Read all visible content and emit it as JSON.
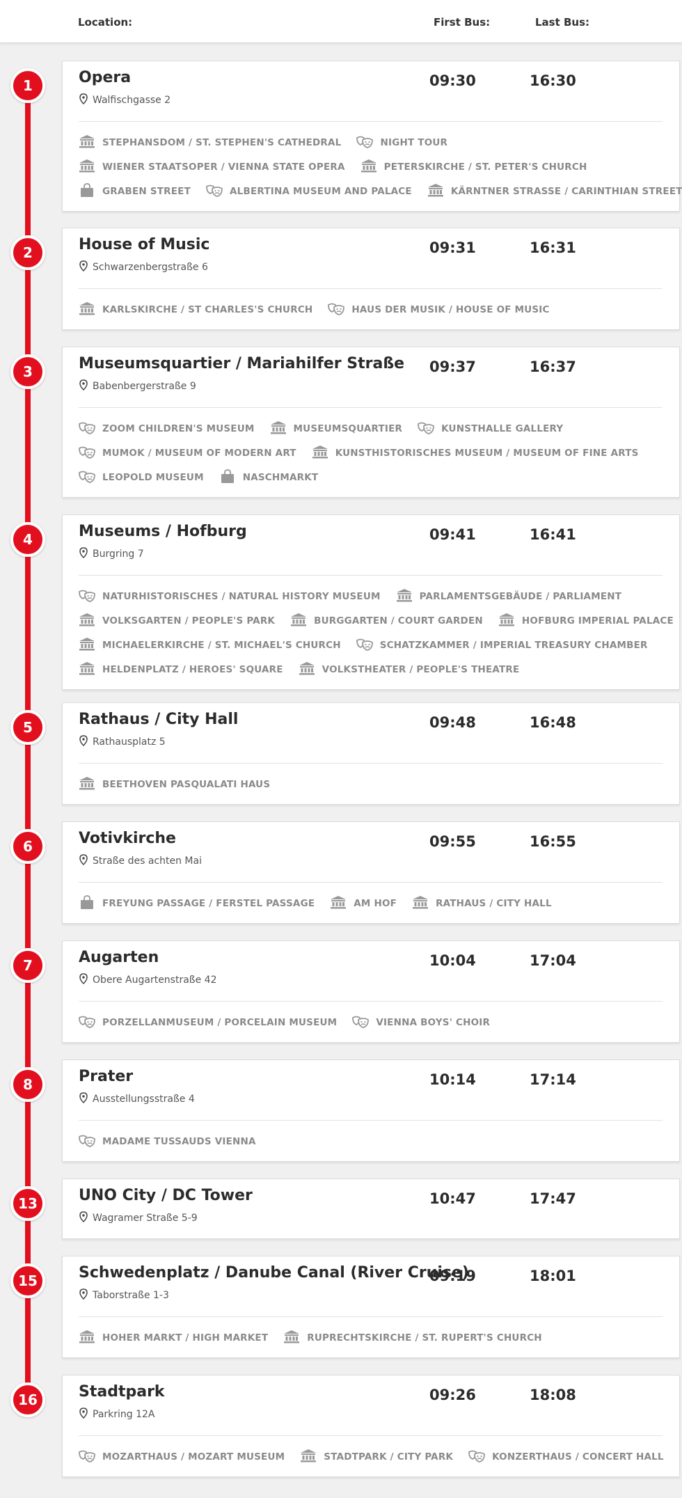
{
  "header": {
    "location_label": "Location:",
    "first_bus_label": "First Bus:",
    "last_bus_label": "Last Bus:"
  },
  "stops": [
    {
      "number": "1",
      "name": "Opera",
      "address": "Walfischgasse 2",
      "first_bus": "09:30",
      "last_bus": "16:30",
      "attractions": [
        [
          {
            "label": "STEPHANSDOM / ST. STEPHEN'S CATHEDRAL",
            "icon": "museum-icon"
          },
          {
            "label": "NIGHT TOUR",
            "icon": "theatre-masks-icon"
          }
        ],
        [
          {
            "label": "WIENER STAATSOPER / VIENNA STATE OPERA",
            "icon": "museum-icon"
          },
          {
            "label": "PETERSKIRCHE / ST. PETER'S CHURCH",
            "icon": "museum-icon"
          }
        ],
        [
          {
            "label": "GRABEN STREET",
            "icon": "shopping-bag-icon"
          },
          {
            "label": "ALBERTINA MUSEUM AND PALACE",
            "icon": "theatre-masks-icon"
          },
          {
            "label": "KÄRNTNER STRASSE / CARINTHIAN STREET",
            "icon": "museum-icon"
          }
        ]
      ]
    },
    {
      "number": "2",
      "name": "House of Music",
      "address": "Schwarzenbergstraße 6",
      "first_bus": "09:31",
      "last_bus": "16:31",
      "attractions": [
        [
          {
            "label": "KARLSKIRCHE / ST CHARLES'S CHURCH",
            "icon": "museum-icon"
          },
          {
            "label": "HAUS DER MUSIK / HOUSE OF MUSIC",
            "icon": "theatre-masks-icon"
          }
        ]
      ]
    },
    {
      "number": "3",
      "name": "Museumsquartier / Mariahilfer Straße",
      "address": "Babenbergerstraße 9",
      "first_bus": "09:37",
      "last_bus": "16:37",
      "attractions": [
        [
          {
            "label": "ZOOM CHILDREN'S MUSEUM",
            "icon": "theatre-masks-icon"
          },
          {
            "label": "MUSEUMSQUARTIER",
            "icon": "museum-icon"
          },
          {
            "label": "KUNSTHALLE GALLERY",
            "icon": "theatre-masks-icon"
          }
        ],
        [
          {
            "label": "MUMOK / MUSEUM OF MODERN ART",
            "icon": "theatre-masks-icon"
          },
          {
            "label": "KUNSTHISTORISCHES MUSEUM / MUSEUM OF FINE ARTS",
            "icon": "museum-icon"
          }
        ],
        [
          {
            "label": "LEOPOLD MUSEUM",
            "icon": "theatre-masks-icon"
          },
          {
            "label": "NASCHMARKT",
            "icon": "shopping-bag-icon"
          }
        ]
      ]
    },
    {
      "number": "4",
      "name": "Museums / Hofburg",
      "address": "Burgring 7",
      "first_bus": "09:41",
      "last_bus": "16:41",
      "attractions": [
        [
          {
            "label": "NATURHISTORISCHES / NATURAL HISTORY MUSEUM",
            "icon": "theatre-masks-icon"
          },
          {
            "label": "PARLAMENTSGEBÄUDE / PARLIAMENT",
            "icon": "museum-icon"
          }
        ],
        [
          {
            "label": "VOLKSGARTEN / PEOPLE'S PARK",
            "icon": "museum-icon"
          },
          {
            "label": "BURGGARTEN / COURT GARDEN",
            "icon": "museum-icon"
          },
          {
            "label": "HOFBURG IMPERIAL PALACE",
            "icon": "museum-icon"
          }
        ],
        [
          {
            "label": "MICHAELERKIRCHE / ST. MICHAEL'S CHURCH",
            "icon": "museum-icon"
          },
          {
            "label": "SCHATZKAMMER / IMPERIAL TREASURY CHAMBER",
            "icon": "theatre-masks-icon"
          }
        ],
        [
          {
            "label": "HELDENPLATZ / HEROES' SQUARE",
            "icon": "museum-icon"
          },
          {
            "label": "VOLKSTHEATER / PEOPLE'S THEATRE",
            "icon": "museum-icon"
          }
        ]
      ]
    },
    {
      "number": "5",
      "name": "Rathaus / City Hall",
      "address": "Rathausplatz 5",
      "first_bus": "09:48",
      "last_bus": "16:48",
      "attractions": [
        [
          {
            "label": "BEETHOVEN PASQUALATI HAUS",
            "icon": "museum-icon"
          }
        ]
      ]
    },
    {
      "number": "6",
      "name": "Votivkirche",
      "address": "Straße des achten Mai",
      "first_bus": "09:55",
      "last_bus": "16:55",
      "attractions": [
        [
          {
            "label": "FREYUNG PASSAGE / FERSTEL PASSAGE",
            "icon": "shopping-bag-icon"
          },
          {
            "label": "AM HOF",
            "icon": "museum-icon"
          },
          {
            "label": "RATHAUS / CITY HALL",
            "icon": "museum-icon"
          }
        ]
      ]
    },
    {
      "number": "7",
      "name": "Augarten",
      "address": "Obere Augartenstraße 42",
      "first_bus": "10:04",
      "last_bus": "17:04",
      "attractions": [
        [
          {
            "label": "PORZELLANMUSEUM / PORCELAIN MUSEUM",
            "icon": "theatre-masks-icon"
          },
          {
            "label": "VIENNA BOYS' CHOIR",
            "icon": "theatre-masks-icon"
          }
        ]
      ]
    },
    {
      "number": "8",
      "name": "Prater",
      "address": "Ausstellungsstraße 4",
      "first_bus": "10:14",
      "last_bus": "17:14",
      "attractions": [
        [
          {
            "label": "MADAME TUSSAUDS VIENNA",
            "icon": "theatre-masks-icon"
          }
        ]
      ]
    },
    {
      "number": "13",
      "name": "UNO City / DC Tower",
      "address": "Wagramer Straße 5-9",
      "first_bus": "10:47",
      "last_bus": "17:47",
      "attractions": []
    },
    {
      "number": "15",
      "name": "Schwedenplatz / Danube Canal (River Cruise)",
      "address": "Taborstraße 1-3",
      "first_bus": "09:19",
      "last_bus": "18:01",
      "attractions": [
        [
          {
            "label": "HOHER MARKT / HIGH MARKET",
            "icon": "museum-icon"
          },
          {
            "label": "RUPRECHTSKIRCHE / ST. RUPERT'S CHURCH",
            "icon": "museum-icon"
          }
        ]
      ]
    },
    {
      "number": "16",
      "name": "Stadtpark",
      "address": "Parkring 12A",
      "first_bus": "09:26",
      "last_bus": "18:08",
      "attractions": [
        [
          {
            "label": "MOZARTHAUS / MOZART MUSEUM",
            "icon": "theatre-masks-icon"
          },
          {
            "label": "STADTPARK / CITY PARK",
            "icon": "museum-icon"
          },
          {
            "label": "KONZERTHAUS / CONCERT HALL",
            "icon": "theatre-masks-icon"
          }
        ]
      ]
    }
  ]
}
